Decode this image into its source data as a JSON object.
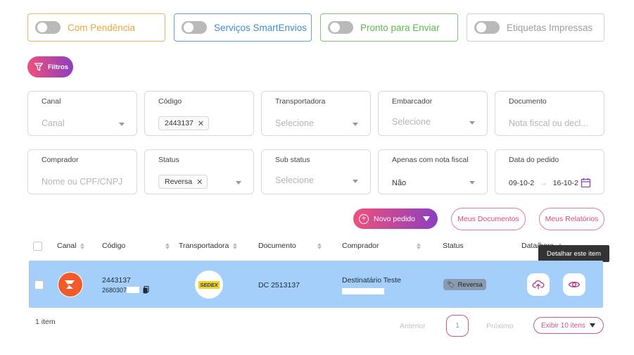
{
  "toggles": [
    {
      "label": "Com Pendência",
      "color": "#f0a540"
    },
    {
      "label": "Serviços SmartEnvios",
      "color": "#3f8fd2"
    },
    {
      "label": "Pronto para Enviar",
      "color": "#5cb84e"
    },
    {
      "label": "Etiquetas Impressas",
      "color": "#9e9e9e"
    }
  ],
  "filtros_label": "Filtros",
  "filters": {
    "canal": {
      "label": "Canal",
      "placeholder": "Canal"
    },
    "codigo": {
      "label": "Código",
      "chip": "2443137"
    },
    "transportadora": {
      "label": "Transportadora",
      "placeholder": "Selecione"
    },
    "embarcador": {
      "label": "Embarcador",
      "placeholder": "Selecione"
    },
    "documento": {
      "label": "Documento",
      "placeholder": "Nota fiscal ou decl..."
    },
    "comprador": {
      "label": "Comprador",
      "placeholder": "Nome ou CPF/CNPJ"
    },
    "status": {
      "label": "Status",
      "chip": "Reversa"
    },
    "sub_status": {
      "label": "Sub status",
      "placeholder": "Selecione"
    },
    "nota_fiscal": {
      "label": "Apenas com nota fiscal",
      "value": "Não"
    },
    "data_pedido": {
      "label": "Data do pedido",
      "start": "09-10-2",
      "end": "16-10-2"
    }
  },
  "actions": {
    "novo_pedido": "Novo pedido",
    "meus_documentos": "Meus Documentos",
    "meus_relatorios": "Meus Relatórios"
  },
  "table": {
    "headers": [
      "Canal",
      "Código",
      "Transportadora",
      "Documento",
      "Comprador",
      "Status",
      "Data/hora"
    ],
    "rows": [
      {
        "codigo": "2443137",
        "codigo_sub": "2680307",
        "transportadora_logo": "SEDEX",
        "documento": "DC 2513137",
        "comprador": "Destinatário Teste",
        "status": "Reversa"
      }
    ],
    "tooltip": "Detalhar este item"
  },
  "footer": {
    "count": "1 item",
    "anterior": "Anterior",
    "page": "1",
    "proximo": "Próximo",
    "exibir": "Exibir 10 itens"
  },
  "colors": {
    "accent_start": "#f0507a",
    "accent_end": "#8a40c0",
    "row_highlight": "#a3cffa"
  }
}
